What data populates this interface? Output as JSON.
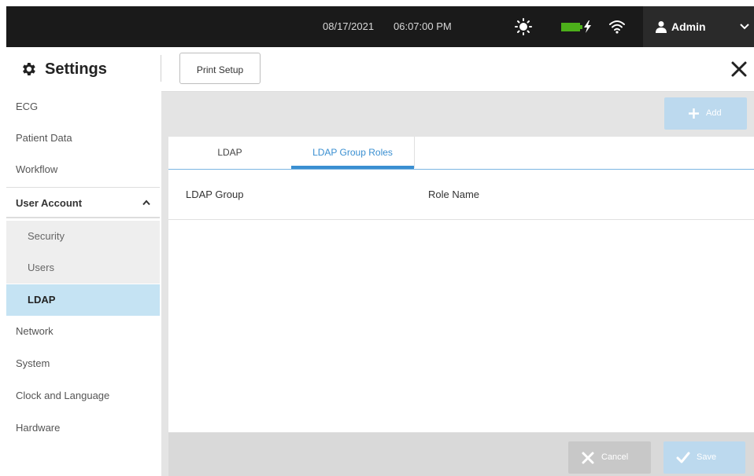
{
  "status_bar": {
    "date": "08/17/2021",
    "time": "06:07:00 PM",
    "icons": [
      "sun-icon",
      "battery-charging-icon",
      "wifi-icon"
    ],
    "user": "Admin"
  },
  "header": {
    "title": "Settings",
    "print_setup": "Print Setup"
  },
  "sidebar": {
    "items": [
      {
        "label": "ECG"
      },
      {
        "label": "Patient Data"
      },
      {
        "label": "Workflow"
      },
      {
        "label": "User Account",
        "expanded": true
      },
      {
        "label": "Security"
      },
      {
        "label": "Users"
      },
      {
        "label": "LDAP",
        "selected": true
      },
      {
        "label": "Network"
      },
      {
        "label": "System"
      },
      {
        "label": "Clock and Language"
      },
      {
        "label": "Hardware"
      }
    ]
  },
  "main": {
    "add_label": "Add",
    "tabs": [
      {
        "label": "LDAP"
      },
      {
        "label": "LDAP Group Roles",
        "active": true
      }
    ],
    "columns": [
      "LDAP Group",
      "Role Name"
    ],
    "rows": [],
    "cancel_label": "Cancel",
    "save_label": "Save"
  },
  "colors": {
    "accent": "#3a8fd1",
    "selected_bg": "#c5e3f3",
    "disabled_primary": "#bcd9ee",
    "topbar": "#1a1a1a",
    "battery": "#4caf1a"
  }
}
